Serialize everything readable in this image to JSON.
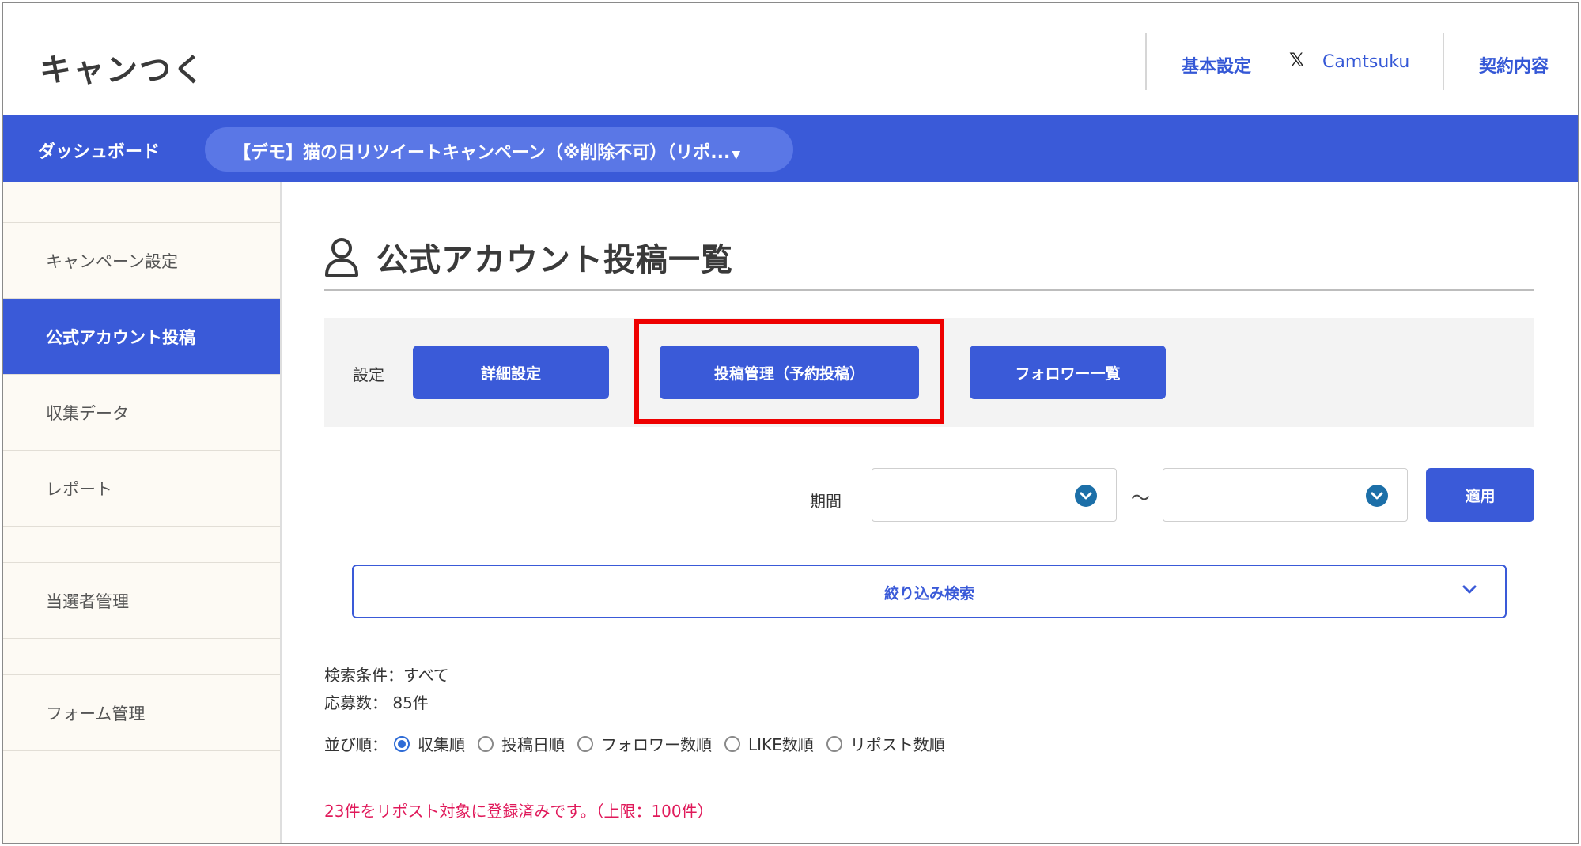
{
  "header": {
    "logo": "キャンつく",
    "links": {
      "basic_settings": "基本設定",
      "x_glyph": "𝕏",
      "account": "Camtsuku",
      "contract": "契約内容"
    }
  },
  "topbar": {
    "dashboard": "ダッシュボード",
    "campaign_selector": "【デモ】猫の日リツイートキャンペーン（※削除不可）（リポ...",
    "caret": "▼"
  },
  "sidebar": {
    "items": [
      {
        "label": "キャンペーン設定"
      },
      {
        "label": "公式アカウント投稿",
        "active": true
      },
      {
        "label": "収集データ"
      },
      {
        "label": "レポート"
      },
      {
        "label": "当選者管理"
      },
      {
        "label": "フォーム管理"
      }
    ]
  },
  "main": {
    "title": "公式アカウント投稿一覧",
    "settings": {
      "label": "設定",
      "buttons": {
        "detail": "詳細設定",
        "post_management": "投稿管理（予約投稿）",
        "followers": "フォロワー一覧"
      }
    },
    "period": {
      "label": "期間",
      "tilde": "〜",
      "start_value": "",
      "end_value": "",
      "apply": "適用"
    },
    "filter": {
      "label": "絞り込み検索",
      "chevron": "⌄"
    },
    "search_condition": "検索条件：すべて",
    "entries": "応募数： 85件",
    "sort": {
      "label": "並び順：",
      "options": [
        {
          "label": "収集順",
          "checked": true
        },
        {
          "label": "投稿日順"
        },
        {
          "label": "フォロワー数順"
        },
        {
          "label": "LIKE数順"
        },
        {
          "label": "リポスト数順"
        }
      ]
    },
    "notice": "23件をリポスト対象に登録済みです。（上限：100件）"
  },
  "colors": {
    "primary": "#3a5ad8",
    "highlight": "#ee0000",
    "notice": "#e0195a"
  }
}
